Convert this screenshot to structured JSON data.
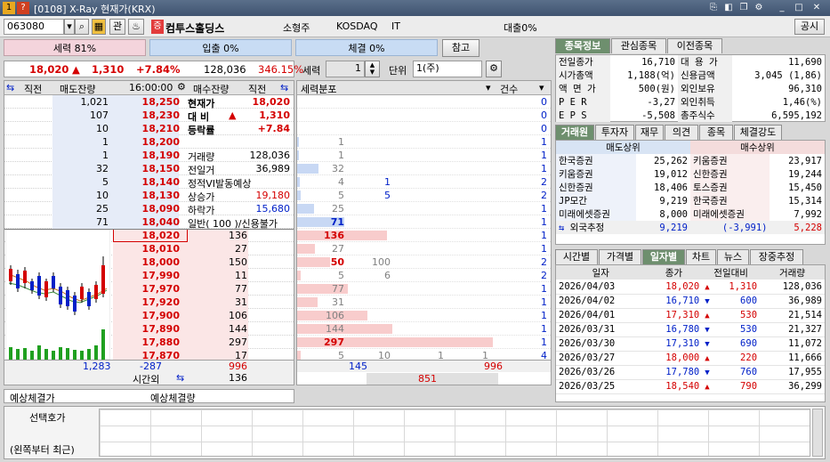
{
  "window": {
    "title": "[0108] X-Ray 현재가(KRX)"
  },
  "toolbar": {
    "code": "063080",
    "name": "컴투스홀딩스",
    "market_type": "소형주",
    "market": "KOSDAQ",
    "sector": "IT",
    "margin": "대출0%",
    "tag1": "관",
    "badge": "증",
    "button_public": "공시"
  },
  "strength_bars": {
    "seller": "세력 81%",
    "inflow": "입출 0%",
    "contract": "체결 0%",
    "ref_button": "참고"
  },
  "price": {
    "current": "18,020",
    "change": "1,310",
    "rate": "+7.84%",
    "volume": "128,036",
    "ratio": "346.15%",
    "up_arrow": "▲"
  },
  "force": {
    "label": "세력",
    "value": "1",
    "unit_label": "단위",
    "unit_value": "1(주)"
  },
  "orderbook": {
    "headers": {
      "prev": "직전",
      "sell": "매도잔량",
      "time": "16:00:00",
      "buy": "매수잔량",
      "prev2": "직전",
      "force_dist": "세력분포",
      "count": "건수"
    },
    "asks": [
      {
        "vol": "1,021",
        "price": "18,250",
        "cnt": "0"
      },
      {
        "vol": "107",
        "price": "18,230",
        "cnt": "0"
      },
      {
        "vol": "10",
        "price": "18,210",
        "cnt": "0"
      },
      {
        "vol": "1",
        "price": "18,200",
        "f1": "1",
        "cnt": "1"
      },
      {
        "vol": "1",
        "price": "18,190",
        "f1": "1",
        "cnt": "1"
      },
      {
        "vol": "32",
        "price": "18,150",
        "f1": "32",
        "cnt": "1"
      },
      {
        "vol": "5",
        "price": "18,140",
        "f1": "4",
        "f2": "1",
        "cnt": "2"
      },
      {
        "vol": "10",
        "price": "18,130",
        "f1": "5",
        "f2": "5",
        "cnt": "2"
      },
      {
        "vol": "25",
        "price": "18,090",
        "f1": "25",
        "cnt": "1"
      },
      {
        "vol": "71",
        "price": "18,040",
        "f1": "71",
        "cnt": "1"
      }
    ],
    "info": [
      {
        "k": "현재가",
        "v": "18,020"
      },
      {
        "k": "대  비",
        "v": "1,310",
        "arrow": "▲"
      },
      {
        "k": "등락률",
        "v": "+7.84"
      },
      {
        "k": "",
        "v": ""
      },
      {
        "k": "거래량",
        "v": "128,036"
      },
      {
        "k": "전일거",
        "v": "36,989"
      },
      {
        "k": "정적VI발동예상",
        "v": ""
      },
      {
        "k": "상승가",
        "v": "19,180"
      },
      {
        "k": "하락가",
        "v": "15,680"
      },
      {
        "k": "일반( 100 )/신용불가",
        "v": ""
      }
    ],
    "bids": [
      {
        "price": "18,020",
        "vol": "136",
        "f1": "136",
        "cnt": "1"
      },
      {
        "price": "18,010",
        "vol": "27",
        "f1": "27",
        "cnt": "1"
      },
      {
        "price": "18,000",
        "vol": "150",
        "f1": "50",
        "f2": "100",
        "cnt": "2"
      },
      {
        "price": "17,990",
        "vol": "11",
        "f1": "5",
        "f2": "6",
        "cnt": "2"
      },
      {
        "price": "17,970",
        "vol": "77",
        "f1": "77",
        "cnt": "1"
      },
      {
        "price": "17,920",
        "vol": "31",
        "f1": "31",
        "cnt": "1"
      },
      {
        "price": "17,900",
        "vol": "106",
        "f1": "106",
        "cnt": "1"
      },
      {
        "price": "17,890",
        "vol": "144",
        "f1": "144",
        "cnt": "1"
      },
      {
        "price": "17,880",
        "vol": "297",
        "f1": "297",
        "cnt": "1"
      },
      {
        "price": "17,870",
        "vol": "17",
        "f1": "5",
        "f2": "10",
        "f3": "1",
        "f4": "1",
        "cnt": "4"
      }
    ],
    "totals": {
      "sell": "1,283",
      "diff": "-287",
      "buy": "996",
      "after_label": "시간외",
      "after_value": "136",
      "f_total1": "145",
      "f_total2": "996",
      "f_total3": "851"
    },
    "expect_price": "예상체결가",
    "expect_vol": "예상체결량"
  },
  "info_tabs": [
    "종목정보",
    "관심종목",
    "이전종목"
  ],
  "stock_info": [
    {
      "k1": "전일종가",
      "v1": "16,710",
      "k2": "대 용 가",
      "v2": "11,690"
    },
    {
      "k1": "시가총액",
      "v1": "1,188(억)",
      "k2": "신용금액",
      "v2": "3,045  (1,86)"
    },
    {
      "k1": "액 면 가",
      "v1": "500(원)",
      "k2": "외인보유",
      "v2": "96,310"
    },
    {
      "k1": "P E R",
      "v1": "-3,27",
      "k2": "외인취득",
      "v2": "1,46(%)"
    },
    {
      "k1": "E P S",
      "v1": "-5,508",
      "k2": "총주식수",
      "v2": "6,595,192"
    }
  ],
  "broker_tabs": [
    "거래원",
    "투자자",
    "재무",
    "의견",
    "종목",
    "체결강도"
  ],
  "broker": {
    "sell_header": "매도상위",
    "buy_header": "매수상위",
    "rows": [
      {
        "s": "한국증권",
        "sv": "25,262",
        "b": "키움증권",
        "bv": "23,917"
      },
      {
        "s": "키움증권",
        "sv": "19,012",
        "b": "신한증권",
        "bv": "19,244"
      },
      {
        "s": "신한증권",
        "sv": "18,406",
        "b": "토스증권",
        "bv": "15,450"
      },
      {
        "s": "JP모간",
        "sv": "9,219",
        "b": "한국증권",
        "bv": "15,314"
      },
      {
        "s": "미래에셋증권",
        "sv": "8,000",
        "b": "미래에셋증권",
        "bv": "7,992"
      }
    ],
    "foreign_label": "외국추정",
    "foreign_sell": "9,219",
    "foreign_net": "(-3,991)",
    "foreign_buy": "5,228"
  },
  "daily_tabs": [
    "시간별",
    "가격별",
    "일자별",
    "차트",
    "뉴스",
    "장중추정"
  ],
  "daily": {
    "headers": [
      "일자",
      "종가",
      "전일대비",
      "거래량"
    ],
    "rows": [
      {
        "d": "2026/04/03",
        "c": "18,020",
        "dir": "up",
        "ch": "1,310",
        "v": "128,036"
      },
      {
        "d": "2026/04/02",
        "c": "16,710",
        "dir": "down",
        "ch": "600",
        "v": "36,989"
      },
      {
        "d": "2026/04/01",
        "c": "17,310",
        "dir": "up",
        "ch": "530",
        "v": "21,514"
      },
      {
        "d": "2026/03/31",
        "c": "16,780",
        "dir": "down",
        "ch": "530",
        "v": "21,327"
      },
      {
        "d": "2026/03/30",
        "c": "17,310",
        "dir": "down",
        "ch": "690",
        "v": "11,072"
      },
      {
        "d": "2026/03/27",
        "c": "18,000",
        "dir": "up",
        "ch": "220",
        "v": "11,666"
      },
      {
        "d": "2026/03/26",
        "c": "17,780",
        "dir": "down",
        "ch": "760",
        "v": "17,955"
      },
      {
        "d": "2026/03/25",
        "c": "18,540",
        "dir": "up",
        "ch": "790",
        "v": "36,299"
      }
    ]
  },
  "bottom": {
    "label1": "선택호가",
    "label2": "(왼쪽부터 최근)"
  },
  "colors": {
    "ask_bg": "#e6ecf8",
    "bid_bg": "#fbe6e6",
    "up": "#d40000",
    "down": "#0020c8",
    "tab_active": "#6e8f6e"
  }
}
